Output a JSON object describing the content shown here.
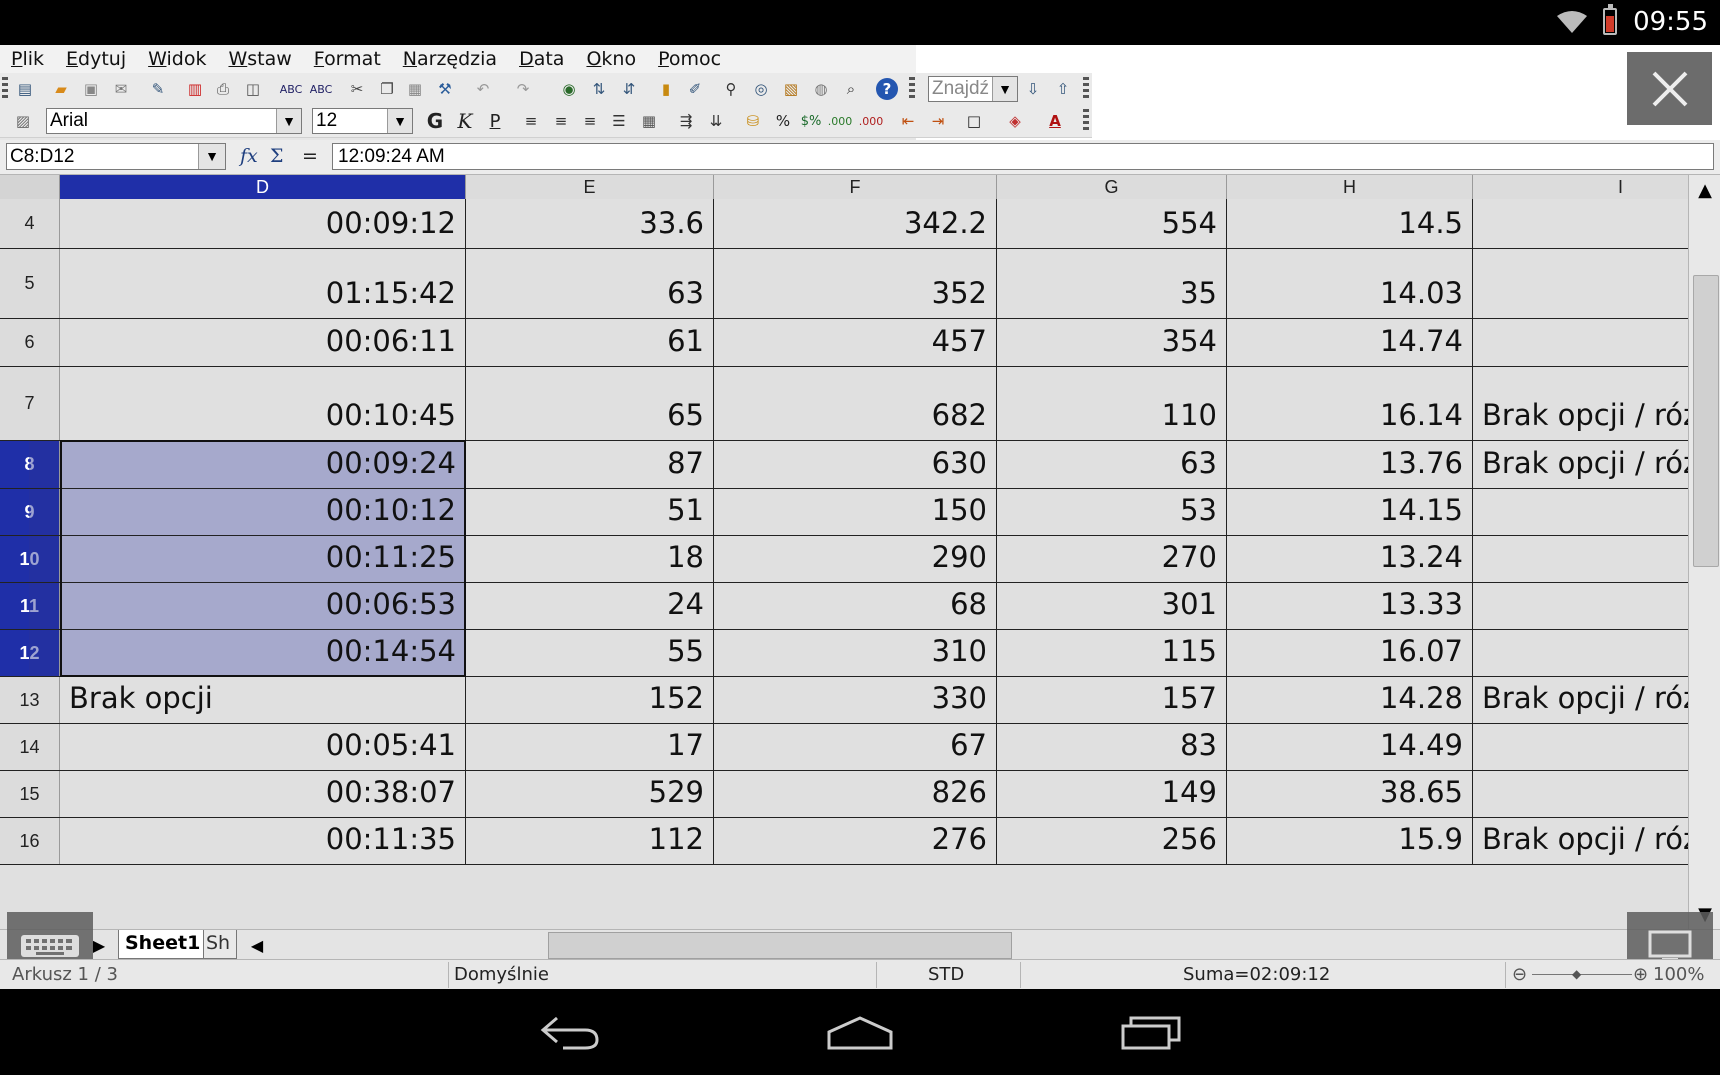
{
  "status_bar": {
    "time": "09:55"
  },
  "menu": [
    "Plik",
    "Edytuj",
    "Widok",
    "Wstaw",
    "Format",
    "Narzędzia",
    "Data",
    "Okno",
    "Pomoc"
  ],
  "toolbar": {
    "font_name": "Arial",
    "font_size": "12",
    "find_placeholder": "Znajdź",
    "bold_label": "G",
    "italic_label": "K",
    "underline_label": "P",
    "percent_label": "%",
    "currency_label": "$%",
    "decimal_label": ".000"
  },
  "formula_bar": {
    "name_box": "C8:D12",
    "formula": "12:09:24 AM",
    "equals": "="
  },
  "columns": [
    "D",
    "E",
    "F",
    "G",
    "H",
    "I"
  ],
  "selected_column": "D",
  "rows": [
    {
      "num": "4",
      "D": "00:09:12",
      "E": "33.6",
      "F": "342.2",
      "G": "554",
      "H": "14.5",
      "I": "",
      "selected": false
    },
    {
      "num": "5",
      "D": "01:15:42",
      "E": "63",
      "F": "352",
      "G": "35",
      "H": "14.03",
      "I": "",
      "selected": false
    },
    {
      "num": "6",
      "D": "00:06:11",
      "E": "61",
      "F": "457",
      "G": "354",
      "H": "14.74",
      "I": "",
      "selected": false
    },
    {
      "num": "7",
      "D": "00:10:45",
      "E": "65",
      "F": "682",
      "G": "110",
      "H": "16.14",
      "I": "Brak opcji / róż",
      "selected": false
    },
    {
      "num": "8",
      "D": "00:09:24",
      "E": "87",
      "F": "630",
      "G": "63",
      "H": "13.76",
      "I": "Brak opcji / róż",
      "selected": true
    },
    {
      "num": "9",
      "D": "00:10:12",
      "E": "51",
      "F": "150",
      "G": "53",
      "H": "14.15",
      "I": "",
      "selected": true
    },
    {
      "num": "10",
      "D": "00:11:25",
      "E": "18",
      "F": "290",
      "G": "270",
      "H": "13.24",
      "I": "",
      "selected": true
    },
    {
      "num": "11",
      "D": "00:06:53",
      "E": "24",
      "F": "68",
      "G": "301",
      "H": "13.33",
      "I": "",
      "selected": true
    },
    {
      "num": "12",
      "D": "00:14:54",
      "E": "55",
      "F": "310",
      "G": "115",
      "H": "16.07",
      "I": "",
      "selected": true
    },
    {
      "num": "13",
      "D": "Brak opcji",
      "E": "152",
      "F": "330",
      "G": "157",
      "H": "14.28",
      "I": "Brak opcji / róż",
      "selected": false
    },
    {
      "num": "14",
      "D": "00:05:41",
      "E": "17",
      "F": "67",
      "G": "83",
      "H": "14.49",
      "I": "",
      "selected": false
    },
    {
      "num": "15",
      "D": "00:38:07",
      "E": "529",
      "F": "826",
      "G": "149",
      "H": "38.65",
      "I": "",
      "selected": false
    },
    {
      "num": "16",
      "D": "00:11:35",
      "E": "112",
      "F": "276",
      "G": "256",
      "H": "15.9",
      "I": "Brak opcji / róż",
      "selected": false
    }
  ],
  "sheet_tabs": [
    "Sheet1",
    "Sh"
  ],
  "status_line": {
    "sheet": "Arkusz 1 / 3",
    "style": "Domyślnie",
    "mode": "STD",
    "sum": "Suma=02:09:12",
    "zoom": "100%"
  }
}
